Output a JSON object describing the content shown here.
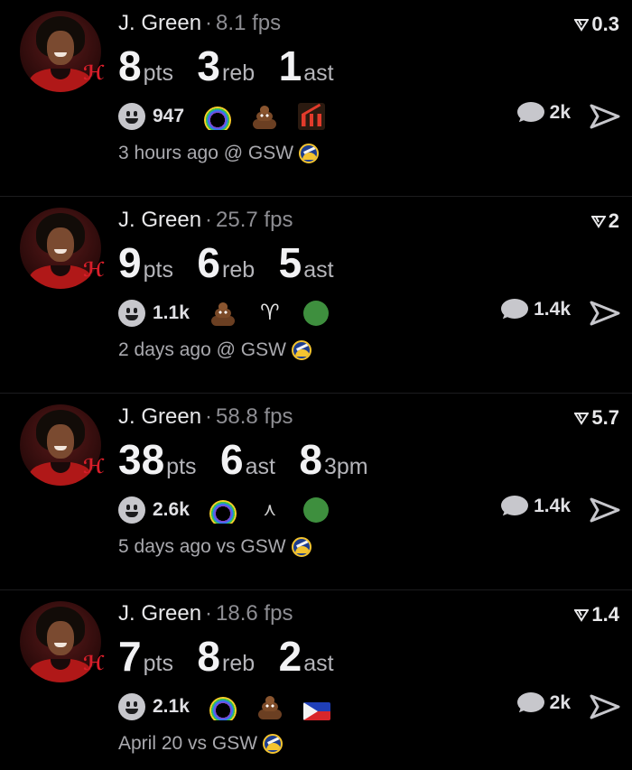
{
  "posts": [
    {
      "player": "J. Green",
      "fps": "8.1 fps",
      "score": "0.3",
      "stats": [
        {
          "value": "8",
          "label": "pts"
        },
        {
          "value": "3",
          "label": "reb"
        },
        {
          "value": "1",
          "label": "ast"
        }
      ],
      "reaction_count": "947",
      "reaction_emojis": [
        "rainbow",
        "poop",
        "declining-chart"
      ],
      "comment_count": "2k",
      "time": "3 hours ago",
      "matchup": "@ GSW"
    },
    {
      "player": "J. Green",
      "fps": "25.7 fps",
      "score": "2",
      "stats": [
        {
          "value": "9",
          "label": "pts"
        },
        {
          "value": "6",
          "label": "reb"
        },
        {
          "value": "5",
          "label": "ast"
        }
      ],
      "reaction_count": "1.1k",
      "reaction_emojis": [
        "poop",
        "goat",
        "green-circle"
      ],
      "comment_count": "1.4k",
      "time": "2 days ago",
      "matchup": "@ GSW"
    },
    {
      "player": "J. Green",
      "fps": "58.8 fps",
      "score": "5.7",
      "stats": [
        {
          "value": "38",
          "label": "pts"
        },
        {
          "value": "6",
          "label": "ast"
        },
        {
          "value": "8",
          "label": "3pm"
        }
      ],
      "reaction_count": "2.6k",
      "reaction_emojis": [
        "rainbow",
        "bird",
        "green-circle"
      ],
      "comment_count": "1.4k",
      "time": "5 days ago",
      "matchup": "vs GSW"
    },
    {
      "player": "J. Green",
      "fps": "18.6 fps",
      "score": "1.4",
      "stats": [
        {
          "value": "7",
          "label": "pts"
        },
        {
          "value": "8",
          "label": "reb"
        },
        {
          "value": "2",
          "label": "ast"
        }
      ],
      "reaction_count": "2.1k",
      "reaction_emojis": [
        "rainbow",
        "poop",
        "philippines-flag"
      ],
      "comment_count": "2k",
      "time": "April 20",
      "matchup": "vs GSW"
    }
  ],
  "colors": {
    "background": "#000000",
    "secondary_text": "#8e8e93",
    "team_logo": "#1d3d8f"
  }
}
